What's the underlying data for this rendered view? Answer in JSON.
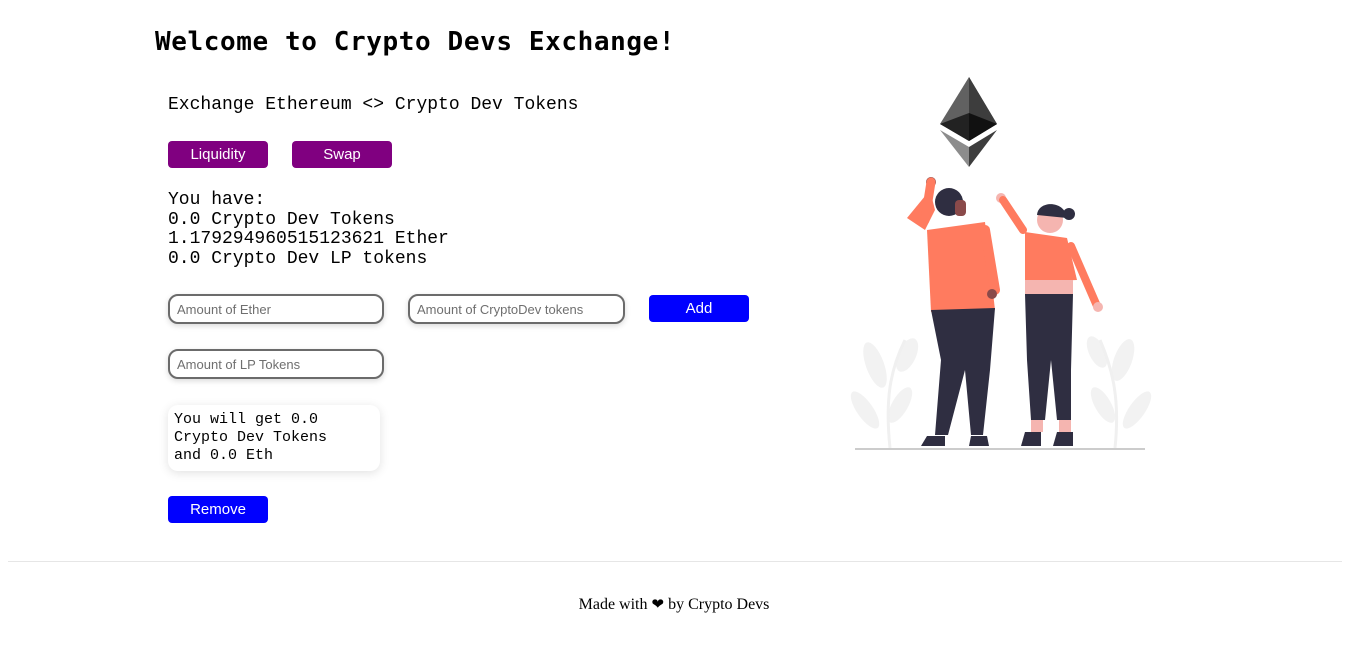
{
  "header": {
    "title": "Welcome to Crypto Devs Exchange!",
    "subtitle": "Exchange Ethereum <> Crypto Dev Tokens"
  },
  "tabs": {
    "liquidity_label": "Liquidity",
    "swap_label": "Swap"
  },
  "balances": {
    "heading": "You have:",
    "crypto_dev_tokens": "0.0 Crypto Dev Tokens",
    "ether": "1.179294960515123621 Ether",
    "lp_tokens": "0.0 Crypto Dev LP tokens"
  },
  "add_liquidity": {
    "ether_placeholder": "Amount of Ether",
    "token_placeholder": "Amount of CryptoDev tokens",
    "add_label": "Add"
  },
  "remove_liquidity": {
    "lp_placeholder": "Amount of LP Tokens",
    "result_line1": "You will get 0.0",
    "result_line2": "Crypto Dev Tokens",
    "result_line3": "and 0.0 Eth",
    "remove_label": "Remove"
  },
  "footer": {
    "made_with": "Made with",
    "heart": "❤",
    "by": "by Crypto Devs"
  },
  "colors": {
    "tab_button": "#800080",
    "action_button": "#0000ff",
    "person_shirt": "#ff7b5f",
    "person_pants": "#2f2e41"
  },
  "icons": {
    "hero": "ethereum-logo-illustration",
    "footer": "heart-icon"
  }
}
